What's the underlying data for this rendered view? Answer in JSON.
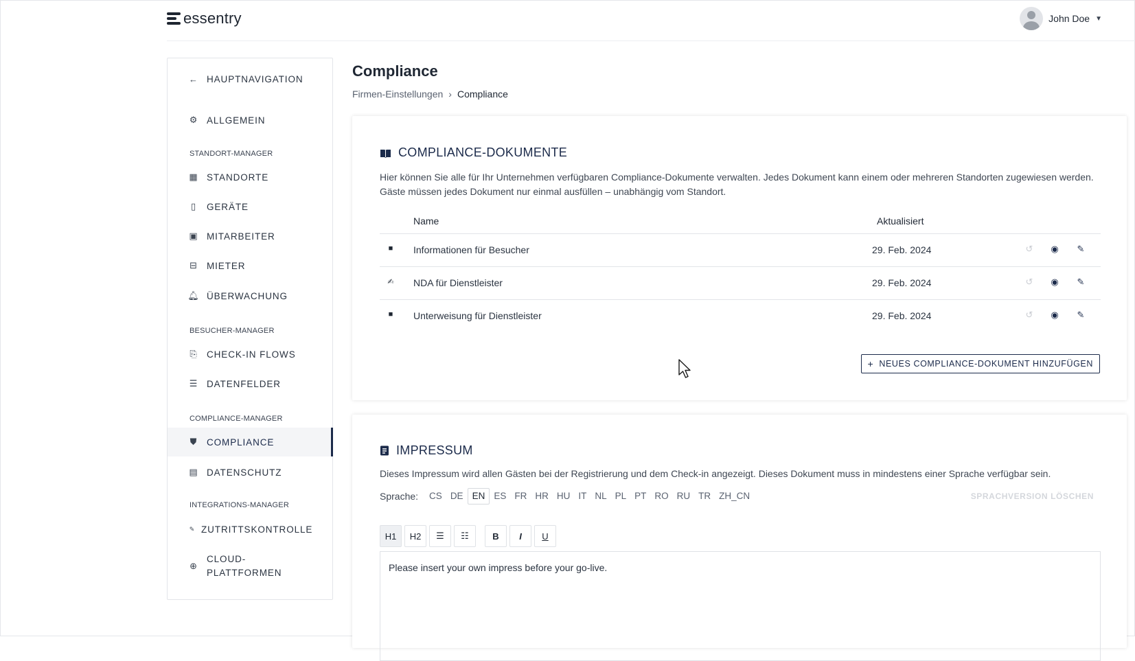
{
  "header": {
    "logo_text": "essentry",
    "user_name": "John Doe"
  },
  "sidebar": {
    "back_label": "HAUPTNAVIGATION",
    "general_label": "ALLGEMEIN",
    "groups": {
      "standort": "STANDORT-MANAGER",
      "besucher": "BESUCHER-MANAGER",
      "compliance": "COMPLIANCE-MANAGER",
      "integrations": "INTEGRATIONS-MANAGER"
    },
    "items": {
      "standorte": "STANDORTE",
      "geraete": "GERÄTE",
      "mitarbeiter": "MITARBEITER",
      "mieter": "MIETER",
      "ueberwachung": "ÜBERWACHUNG",
      "checkin": "CHECK-IN FLOWS",
      "datenfelder": "DATENFELDER",
      "compliance": "COMPLIANCE",
      "datenschutz": "DATENSCHUTZ",
      "zutritt": "ZUTRITTSKONTROLLE",
      "cloud": "CLOUD-PLATTFORMEN"
    }
  },
  "page": {
    "title": "Compliance",
    "breadcrumb": {
      "parent": "Firmen-Einstellungen",
      "current": "Compliance"
    }
  },
  "documents": {
    "title": "COMPLIANCE-DOKUMENTE",
    "description": "Hier können Sie alle für Ihr Unternehmen verfügbaren Compliance-Dokumente verwalten. Jedes Dokument kann einem oder mehreren Standorten zugewiesen werden. Gäste müssen jedes Dokument nur einmal ausfüllen – unabhängig vom Standort.",
    "col_name": "Name",
    "col_updated": "Aktualisiert",
    "rows": [
      {
        "name": "Informationen für Besucher",
        "updated": "29. Feb. 2024",
        "icon": "video-icon"
      },
      {
        "name": "NDA für Dienstleister",
        "updated": "29. Feb. 2024",
        "icon": "signature-icon"
      },
      {
        "name": "Unterweisung für Dienstleister",
        "updated": "29. Feb. 2024",
        "icon": "video-icon"
      }
    ],
    "add_button": "NEUES COMPLIANCE-DOKUMENT HINZUFÜGEN"
  },
  "impressum": {
    "title": "IMPRESSUM",
    "description": "Dieses Impressum wird allen Gästen bei der Registrierung und dem Check-in angezeigt. Dieses Dokument muss in mindestens einer Sprache verfügbar sein.",
    "language_label": "Sprache:",
    "languages": [
      "CS",
      "DE",
      "EN",
      "ES",
      "FR",
      "HR",
      "HU",
      "IT",
      "NL",
      "PL",
      "PT",
      "RO",
      "RU",
      "TR",
      "ZH_CN"
    ],
    "selected_language": "EN",
    "delete_label": "SPRACHVERSION LÖSCHEN",
    "toolbar": {
      "h1": "H1",
      "h2": "H2",
      "bold": "B",
      "italic": "I",
      "underline": "U"
    },
    "content": "Please insert your own impress before your go-live."
  }
}
